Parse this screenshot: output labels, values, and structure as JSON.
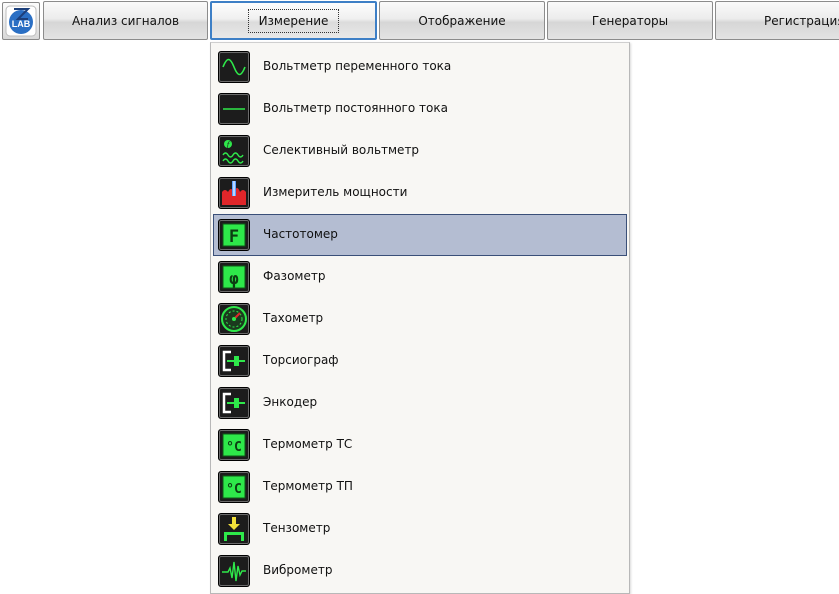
{
  "toolbar": {
    "logo_text": "LAB",
    "tabs": [
      {
        "label": "Анализ сигналов"
      },
      {
        "label": "Измерение"
      },
      {
        "label": "Отображение"
      },
      {
        "label": "Генераторы"
      },
      {
        "label": "Регистрация"
      }
    ],
    "active_tab": "Измерение"
  },
  "measure_menu": {
    "items": [
      {
        "label": "Вольтметр переменного тока",
        "icon": "sine-wave-icon"
      },
      {
        "label": "Вольтметр постоянного тока",
        "icon": "dc-line-icon"
      },
      {
        "label": "Селективный вольтметр",
        "icon": "selective-wave-icon"
      },
      {
        "label": "Измеритель мощности",
        "icon": "power-meter-icon"
      },
      {
        "label": "Частотомер",
        "icon": "frequency-f-icon"
      },
      {
        "label": "Фазометр",
        "icon": "phase-icon"
      },
      {
        "label": "Тахометр",
        "icon": "tachometer-gauge-icon"
      },
      {
        "label": "Торсиограф",
        "icon": "torsiograph-icon"
      },
      {
        "label": "Энкодер",
        "icon": "encoder-icon"
      },
      {
        "label": "Термометр ТС",
        "icon": "thermometer-celsius-icon"
      },
      {
        "label": "Термометр ТП",
        "icon": "thermocouple-celsius-icon"
      },
      {
        "label": "Тензометр",
        "icon": "strain-gauge-icon"
      },
      {
        "label": "Виброметр",
        "icon": "vibration-wave-icon"
      }
    ],
    "selected_item": "Частотомер"
  },
  "colors": {
    "accent_green": "#2ee84a",
    "selection_bg": "#b4bdd2",
    "selection_border": "#3a4f78",
    "active_tab_border": "#3d7fc6",
    "logo_blue": "#2a6fc4"
  }
}
